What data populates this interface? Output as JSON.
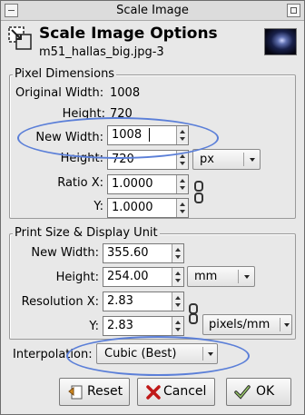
{
  "window": {
    "title": "Scale Image"
  },
  "header": {
    "title": "Scale Image Options",
    "subtitle": "m51_hallas_big.jpg-3"
  },
  "pixel_dimensions": {
    "section_label": "Pixel Dimensions",
    "original_width_label": "Original Width:",
    "original_width_value": "1008",
    "height_label": "Height:",
    "height_value": "720",
    "new_width_label": "New Width:",
    "new_width_value": "1008",
    "new_height_label": "Height:",
    "new_height_value": "720",
    "unit": "px",
    "ratio_x_label": "Ratio X:",
    "ratio_x_value": "1.0000",
    "ratio_y_label": "Y:",
    "ratio_y_value": "1.0000"
  },
  "print_size": {
    "section_label": "Print Size & Display Unit",
    "new_width_label": "New Width:",
    "new_width_value": "355.60",
    "height_label": "Height:",
    "height_value": "254.00",
    "unit": "mm",
    "res_x_label": "Resolution X:",
    "res_x_value": "2.83",
    "res_y_label": "Y:",
    "res_y_value": "2.83",
    "res_unit": "pixels/mm"
  },
  "interpolation": {
    "label": "Interpolation:",
    "value": "Cubic (Best)"
  },
  "buttons": {
    "reset": "Reset",
    "cancel": "Cancel",
    "ok": "OK"
  },
  "colors": {
    "annotation_ellipse": "#5b7fd8",
    "window_bg": "#e8e8e8"
  }
}
